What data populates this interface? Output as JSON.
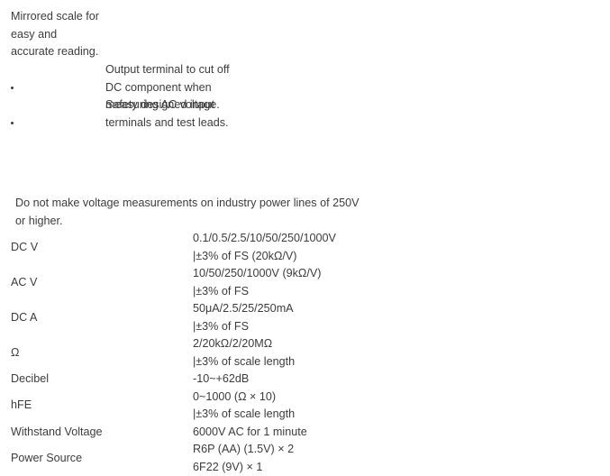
{
  "feature_notes": {
    "intro_lines": [
      "Mirrored scale for",
      "easy and",
      "accurate reading."
    ],
    "bullets": [
      {
        "marker": "•",
        "lines": [
          "Output terminal to cut off",
          "DC component when",
          "measuring AC voltage."
        ]
      },
      {
        "marker": "•",
        "lines": [
          "Safety designed input",
          "terminals and test leads."
        ]
      }
    ]
  },
  "warning": {
    "lines": [
      "Do not make voltage measurements on industry power lines of 250V",
      "or higher."
    ]
  },
  "spec_table": {
    "rows": [
      {
        "label": "DC V",
        "values": [
          "0.1/0.5/2.5/10/50/250/1000V",
          "|±3% of FS (20kΩ/V)"
        ]
      },
      {
        "label": "AC V",
        "values": [
          "10/50/250/1000V (9kΩ/V)",
          "|±3% of FS"
        ]
      },
      {
        "label": "DC A",
        "values": [
          "50μA/2.5/25/250mA",
          "|±3% of FS"
        ]
      },
      {
        "label": "Ω",
        "values": [
          "2/20kΩ/2/20MΩ",
          "|±3% of scale length"
        ]
      },
      {
        "label": "Decibel",
        "values": [
          "-10~+62dB"
        ]
      },
      {
        "label": "hFE",
        "values": [
          "0~1000 (Ω × 10)",
          "|±3% of scale length"
        ]
      },
      {
        "label": "Withstand Voltage",
        "values": [
          "6000V AC for 1 minute"
        ]
      },
      {
        "label": "Power Source",
        "values": [
          "R6P (AA) (1.5V) × 2",
          "6F22 (9V) × 1"
        ]
      }
    ]
  },
  "colors": {
    "background": "#ffffff",
    "text": "#3c3c3c"
  }
}
